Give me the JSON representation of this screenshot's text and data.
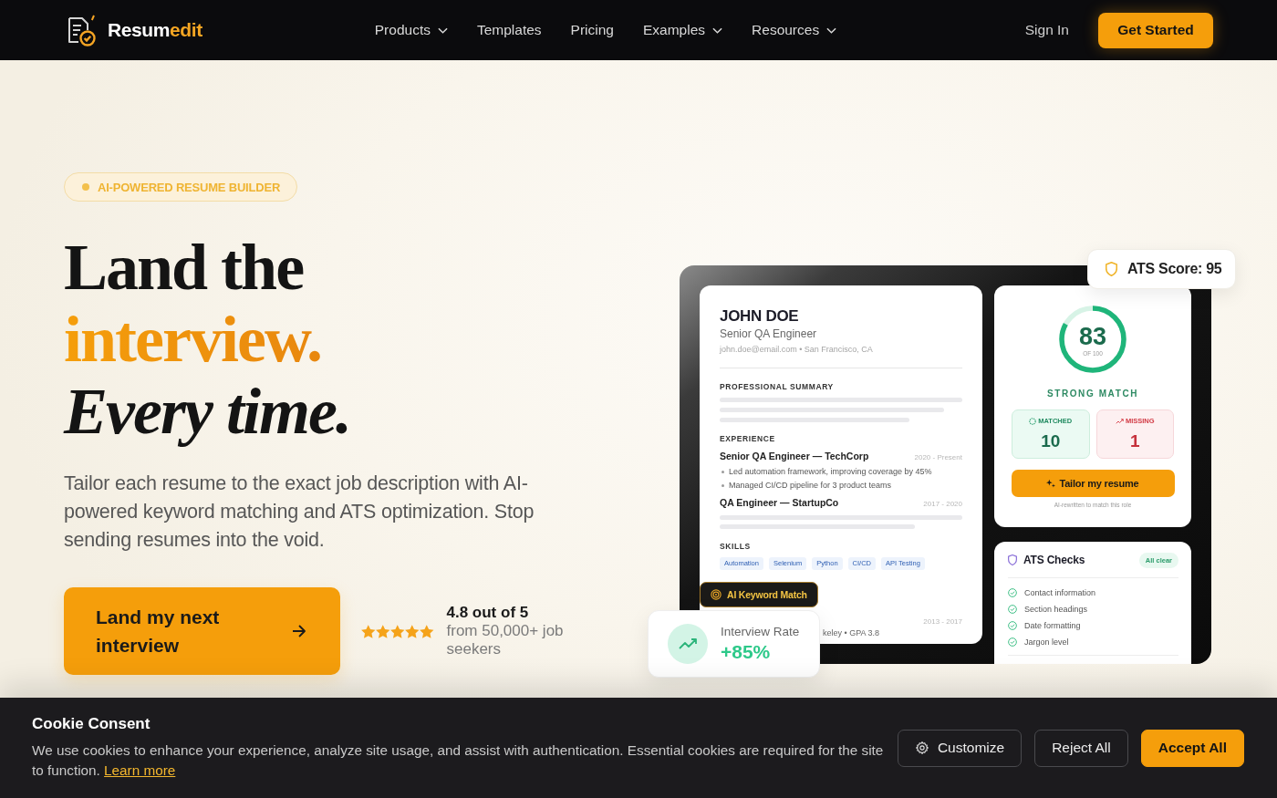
{
  "nav": {
    "brand": {
      "name": "Resum",
      "name_accent": "edit"
    },
    "links": [
      {
        "label": "Products",
        "dropdown": true
      },
      {
        "label": "Templates",
        "dropdown": false
      },
      {
        "label": "Pricing",
        "dropdown": false
      },
      {
        "label": "Examples",
        "dropdown": true
      },
      {
        "label": "Resources",
        "dropdown": true
      }
    ],
    "sign_in": "Sign In",
    "cta": "Get Started"
  },
  "hero": {
    "badge": "AI-POWERED RESUME BUILDER",
    "headline": [
      {
        "text": "Land the",
        "kind": "plain"
      },
      {
        "text": "interview.",
        "kind": "accent"
      },
      {
        "text": "Every time.",
        "kind": "italic"
      }
    ],
    "description": "Tailor each resume to the exact job description with AI-powered keyword matching and ATS optimization. Stop sending resumes into the void.",
    "cta": "Land my next interview",
    "rating": {
      "stars": 5,
      "score": "4.8 out of 5",
      "caption": "from 50,000+ job seekers"
    }
  },
  "preview": {
    "ats_score": "ATS Score: 95",
    "resume": {
      "name": "JOHN DOE",
      "title": "Senior QA Engineer",
      "contact": "john.doe@email.com • San Francisco, CA",
      "summary_heading": "PROFESSIONAL SUMMARY",
      "experience_heading": "EXPERIENCE",
      "jobs": [
        {
          "role": "Senior QA Engineer — TechCorp",
          "dates": "2020 - Present",
          "bullets": [
            "Led automation framework, improving coverage by 45%",
            "Managed CI/CD pipeline for 3 product teams"
          ]
        },
        {
          "role": "QA Engineer — StartupCo",
          "dates": "2017 - 2020"
        }
      ],
      "skills_heading": "SKILLS",
      "skills": [
        "Automation",
        "Selenium",
        "Python",
        "CI/CD",
        "API Testing"
      ],
      "education": {
        "dates": "2013 - 2017",
        "detail": "keley • GPA 3.8"
      }
    },
    "keyword_badge": "AI Keyword Match",
    "interview_rate": {
      "label": "Interview Rate",
      "value": "+85%"
    },
    "score": {
      "value": "83",
      "scale": "OF 100",
      "level": 0.83,
      "verdict": "STRONG MATCH",
      "matched": {
        "label": "MATCHED",
        "count": "10"
      },
      "missing": {
        "label": "MISSING",
        "count": "1"
      },
      "action": "Tailor my resume",
      "note": "AI-rewritten to match this role"
    },
    "checks": {
      "title": "ATS Checks",
      "status": "All clear",
      "items": [
        {
          "label": "Contact information",
          "passed": true
        },
        {
          "label": "Section headings",
          "passed": true
        },
        {
          "label": "Date formatting",
          "passed": true
        },
        {
          "label": "Jargon level",
          "passed": true
        }
      ]
    }
  },
  "cookie": {
    "title": "Cookie Consent",
    "text": "We use cookies to enhance your experience, analyze site usage, and assist with authentication. Essential cookies are required for the site to function.",
    "link": "Learn more",
    "buttons": [
      {
        "label": "Customize",
        "kind": "settings"
      },
      {
        "label": "Reject All",
        "kind": "secondary"
      },
      {
        "label": "Accept All",
        "kind": "primary"
      }
    ]
  }
}
